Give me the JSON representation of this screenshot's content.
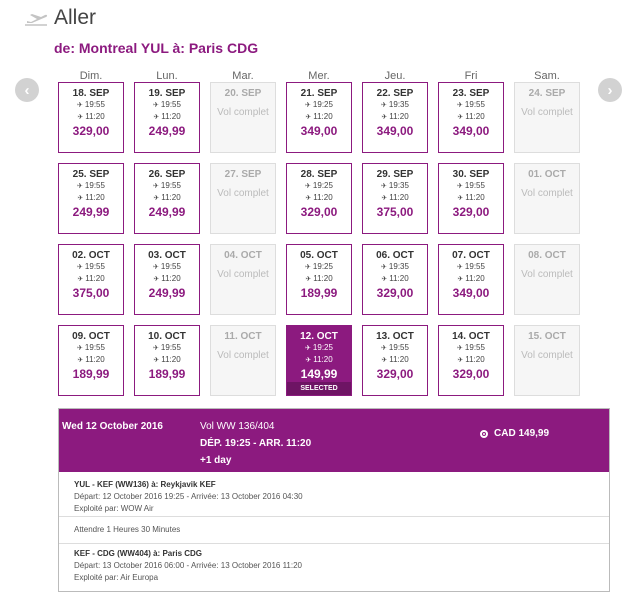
{
  "header": {
    "icon": "plane-takeoff-icon",
    "title": "Aller",
    "route": "de: Montreal YUL à: Paris CDG"
  },
  "nav": {
    "prev_icon": "chevron-left-icon",
    "prev": "‹",
    "next_icon": "chevron-right-icon",
    "next": "›"
  },
  "colors": {
    "accent": "#8c1a7f",
    "full_bg": "#f6f6f6",
    "text": "#333333"
  },
  "days": [
    "Dim.",
    "Lun.",
    "Mar.",
    "Mer.",
    "Jeu.",
    "Fri",
    "Sam."
  ],
  "full_label": "Vol complet",
  "selected_label": "SELECTED",
  "weeks": [
    [
      {
        "date": "18. SEP",
        "dep": "19:55",
        "arr": "11:20",
        "price": "329,00"
      },
      {
        "date": "19. SEP",
        "dep": "19:55",
        "arr": "11:20",
        "price": "249,99"
      },
      {
        "date": "20. SEP",
        "full": true
      },
      {
        "date": "21. SEP",
        "dep": "19:25",
        "arr": "11:20",
        "price": "349,00"
      },
      {
        "date": "22. SEP",
        "dep": "19:35",
        "arr": "11:20",
        "price": "349,00"
      },
      {
        "date": "23. SEP",
        "dep": "19:55",
        "arr": "11:20",
        "price": "349,00"
      },
      {
        "date": "24. SEP",
        "full": true
      }
    ],
    [
      {
        "date": "25. SEP",
        "dep": "19:55",
        "arr": "11:20",
        "price": "249,99"
      },
      {
        "date": "26. SEP",
        "dep": "19:55",
        "arr": "11:20",
        "price": "249,99"
      },
      {
        "date": "27. SEP",
        "full": true
      },
      {
        "date": "28. SEP",
        "dep": "19:25",
        "arr": "11:20",
        "price": "329,00"
      },
      {
        "date": "29. SEP",
        "dep": "19:35",
        "arr": "11:20",
        "price": "375,00"
      },
      {
        "date": "30. SEP",
        "dep": "19:55",
        "arr": "11:20",
        "price": "329,00"
      },
      {
        "date": "01. OCT",
        "full": true
      }
    ],
    [
      {
        "date": "02. OCT",
        "dep": "19:55",
        "arr": "11:20",
        "price": "375,00"
      },
      {
        "date": "03. OCT",
        "dep": "19:55",
        "arr": "11:20",
        "price": "249,99"
      },
      {
        "date": "04. OCT",
        "full": true
      },
      {
        "date": "05. OCT",
        "dep": "19:25",
        "arr": "11:20",
        "price": "189,99"
      },
      {
        "date": "06. OCT",
        "dep": "19:35",
        "arr": "11:20",
        "price": "329,00"
      },
      {
        "date": "07. OCT",
        "dep": "19:55",
        "arr": "11:20",
        "price": "349,00"
      },
      {
        "date": "08. OCT",
        "full": true
      }
    ],
    [
      {
        "date": "09. OCT",
        "dep": "19:55",
        "arr": "11:20",
        "price": "189,99"
      },
      {
        "date": "10. OCT",
        "dep": "19:55",
        "arr": "11:20",
        "price": "189,99"
      },
      {
        "date": "11. OCT",
        "full": true
      },
      {
        "date": "12. OCT",
        "dep": "19:25",
        "arr": "11:20",
        "price": "149,99",
        "selected": true
      },
      {
        "date": "13. OCT",
        "dep": "19:55",
        "arr": "11:20",
        "price": "329,00"
      },
      {
        "date": "14. OCT",
        "dep": "19:55",
        "arr": "11:20",
        "price": "329,00"
      },
      {
        "date": "15. OCT",
        "full": true
      }
    ]
  ],
  "detail": {
    "date": "Wed 12 October 2016",
    "vol": "Vol  WW 136/404",
    "times": "DÉP. 19:25 - ARR. 11:20",
    "plus_day": "+1 day",
    "fare": "CAD 149,99",
    "segments": [
      {
        "head": "YUL - KEF (WW136) à: Reykjavik KEF",
        "times": "Départ: 12 October 2016 19:25 - Arrivée: 13 October 2016 04:30",
        "operator": "Exploité par: WOW Air"
      },
      {
        "head": "KEF - CDG (WW404) à: Paris CDG",
        "times": "Départ: 13 October 2016 06:00 - Arrivée: 13 October 2016 11:20",
        "operator": "Exploité par: Air Europa"
      }
    ],
    "wait": "Attendre 1 Heures 30 Minutes"
  }
}
